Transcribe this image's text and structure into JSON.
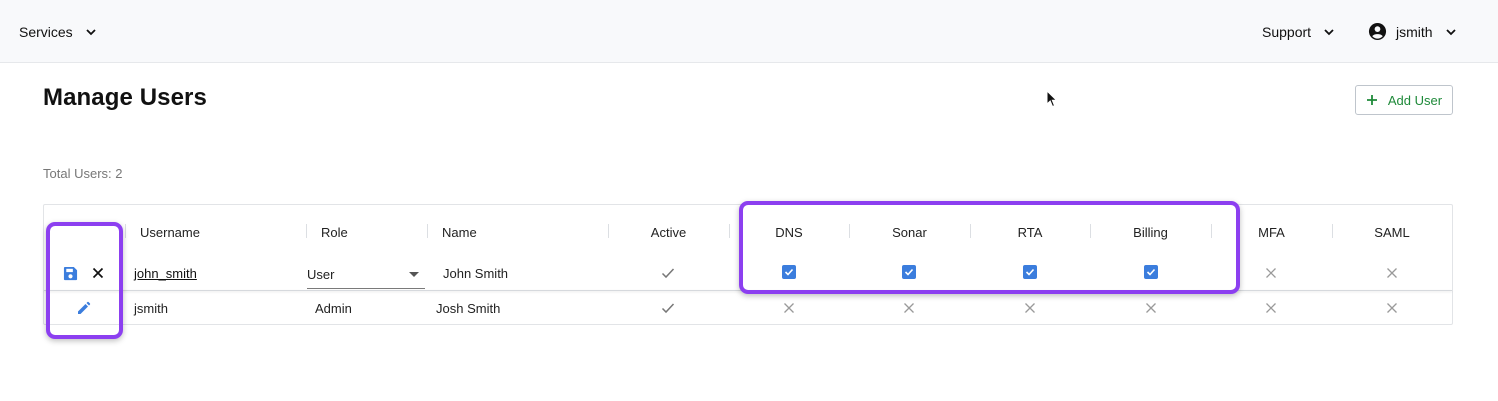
{
  "nav": {
    "services_label": "Services",
    "support_label": "Support",
    "user_label": "jsmith"
  },
  "page": {
    "title": "Manage Users",
    "add_user_label": "Add User",
    "total_users": "Total Users: 2"
  },
  "table": {
    "columns": [
      "Username",
      "Role",
      "Name",
      "Active",
      "DNS",
      "Sonar",
      "RTA",
      "Billing",
      "MFA",
      "SAML"
    ],
    "rows": [
      {
        "mode": "editing",
        "username": "john_smith",
        "role": "User",
        "name": "John Smith",
        "active": true,
        "dns": true,
        "sonar": true,
        "rta": true,
        "billing": true,
        "mfa": false,
        "saml": false
      },
      {
        "mode": "view",
        "username": "jsmith",
        "role": "Admin",
        "name": "Josh Smith",
        "active": true,
        "dns": false,
        "sonar": false,
        "rta": false,
        "billing": false,
        "mfa": false,
        "saml": false
      }
    ]
  },
  "icons": {
    "save": "save-icon",
    "cancel": "close-icon",
    "edit": "pencil-icon",
    "check": "check-icon",
    "cross": "x-icon",
    "checkbox": "checkbox-checked-icon",
    "add": "plus-icon",
    "account": "account-circle-icon",
    "dropdown": "chevron-down-icon"
  },
  "colors": {
    "accent_blue": "#3b7ddd",
    "highlight_purple": "#8c3ff0",
    "add_green": "#1f8a3a",
    "topbar_bg": "#f8f9fb"
  }
}
